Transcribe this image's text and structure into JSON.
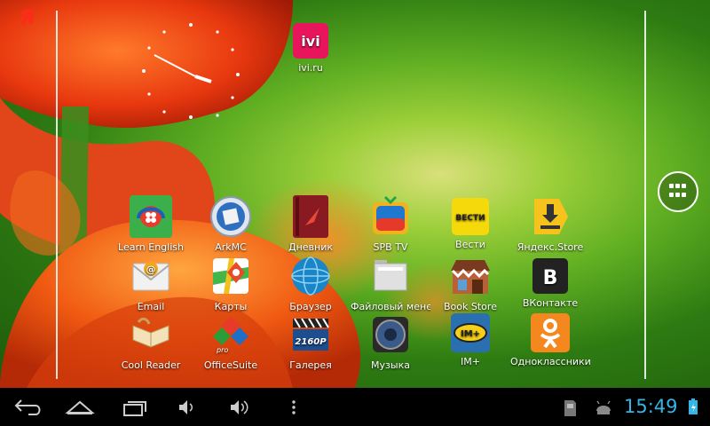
{
  "launcher": {
    "yandex_logo": "Я",
    "shortcut_top": {
      "label": "ivi.ru",
      "icon": "ivi-icon"
    },
    "apps": [
      {
        "label": "Learn English",
        "icon": "learn-english-icon"
      },
      {
        "label": "ArkMC",
        "icon": "arkmc-icon"
      },
      {
        "label": "Дневник",
        "icon": "diary-icon"
      },
      {
        "label": "SPB TV",
        "icon": "spb-tv-icon"
      },
      {
        "label": "Вести",
        "icon": "vesti-icon"
      },
      {
        "label": "Яндекс.Store",
        "icon": "yandex-store-icon"
      },
      {
        "label": "Email",
        "icon": "email-icon"
      },
      {
        "label": "Карты",
        "icon": "maps-icon"
      },
      {
        "label": "Браузер",
        "icon": "browser-icon"
      },
      {
        "label": "Файловый менеджер",
        "icon": "file-manager-icon"
      },
      {
        "label": "Book Store",
        "icon": "book-store-icon"
      },
      {
        "label": "ВКонтакте",
        "icon": "vkontakte-icon"
      },
      {
        "label": "Cool Reader",
        "icon": "cool-reader-icon"
      },
      {
        "label": "OfficeSuite",
        "icon": "officesuite-icon"
      },
      {
        "label": "Галерея",
        "icon": "gallery-icon"
      },
      {
        "label": "Музыка",
        "icon": "music-icon"
      },
      {
        "label": "IM+",
        "icon": "im-plus-icon"
      },
      {
        "label": "Одноклассники",
        "icon": "odnoklassniki-icon"
      }
    ],
    "icon_texts": {
      "vesti": "ВЕСТИ",
      "vk": "B",
      "gallery": "2160P",
      "implus": "IM+",
      "office": "pro"
    }
  },
  "status_bar": {
    "time": "15:49",
    "accent_color": "#33b5e5",
    "icons": [
      "sd-card-icon",
      "android-debug-icon",
      "battery-charging-icon"
    ]
  },
  "navigation": [
    "back-icon",
    "home-icon",
    "recent-apps-icon",
    "volume-down-icon",
    "volume-up-icon",
    "menu-icon"
  ]
}
